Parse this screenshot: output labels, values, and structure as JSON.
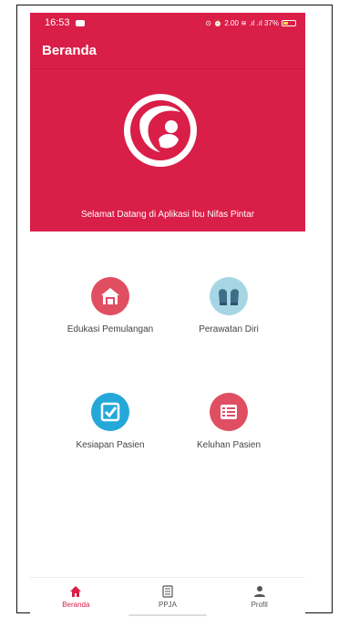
{
  "status_bar": {
    "time": "16:53",
    "indicators": "⊙ ⏰ 2.00 ≋ .ıl .ıl 37%"
  },
  "app_bar": {
    "title": "Beranda"
  },
  "hero": {
    "welcome_text": "Selamat Datang di Aplikasi Ibu Nifas Pintar",
    "logo_icon": "mother-baby-logo-icon"
  },
  "menu": [
    {
      "label": "Edukasi Pemulangan",
      "icon": "house-icon",
      "color": "#e04e62"
    },
    {
      "label": "Perawatan Diri",
      "icon": "mittens-icon",
      "color": "#a6d6e4"
    },
    {
      "label": "Kesiapan Pasien",
      "icon": "checkbox-icon",
      "color": "#24a8d9"
    },
    {
      "label": "Keluhan Pasien",
      "icon": "list-icon",
      "color": "#e04e62"
    }
  ],
  "bottom_nav": [
    {
      "label": "Beranda",
      "icon": "home-icon",
      "active": true
    },
    {
      "label": "PPJA",
      "icon": "document-icon",
      "active": false
    },
    {
      "label": "Profil",
      "icon": "person-icon",
      "active": false
    }
  ],
  "colors": {
    "primary": "#d91e48",
    "accent_blue": "#24a8d9"
  }
}
